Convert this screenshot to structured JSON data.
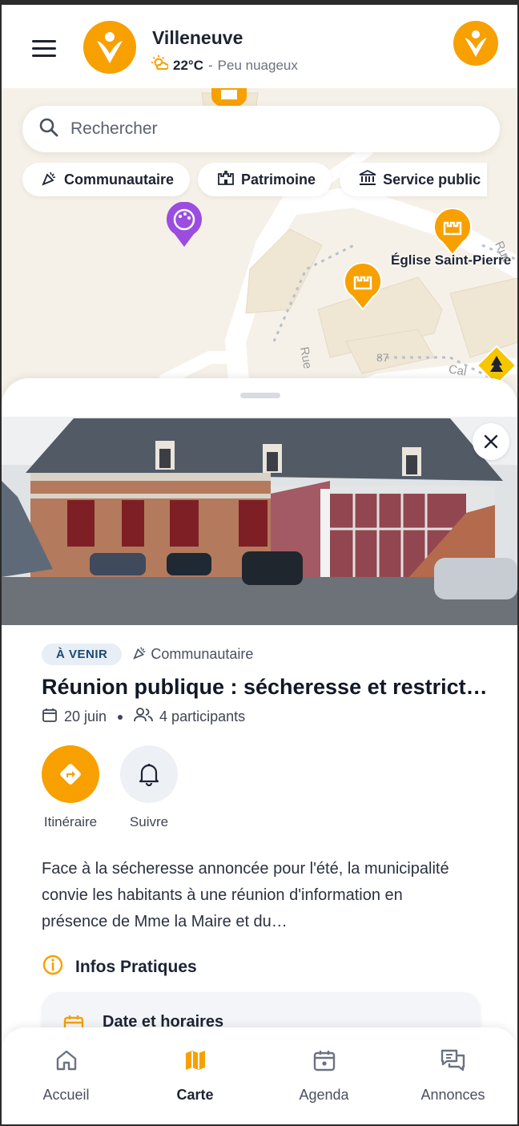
{
  "header": {
    "city": "Villeneuve",
    "temperature": "22°C",
    "separator": "-",
    "condition": "Peu nuageux"
  },
  "search": {
    "placeholder": "Rechercher"
  },
  "filters": [
    {
      "label": "Communautaire",
      "icon": "party-popper-icon"
    },
    {
      "label": "Patrimoine",
      "icon": "castle-icon"
    },
    {
      "label": "Service public",
      "icon": "bank-icon"
    }
  ],
  "map": {
    "place_label": "Église Saint-Pierre",
    "street_1": "Rue",
    "street_2": "Cal",
    "street_3": "Rue",
    "house_number": "87"
  },
  "event": {
    "status": "À VENIR",
    "category": "Communautaire",
    "title": "Réunion publique : sécheresse et restrict…",
    "date": "20 juin",
    "participants": "4 participants",
    "actions": {
      "directions": "Itinéraire",
      "follow": "Suivre"
    },
    "description": "Face à la sécheresse annoncée pour l'été, la municipalité convie les habitants à une réunion d'information en présence de Mme la Maire et du…",
    "infos_title": "Infos Pratiques",
    "schedule_title": "Date et horaires"
  },
  "nav": {
    "home": "Accueil",
    "map": "Carte",
    "agenda": "Agenda",
    "announcements": "Annonces",
    "active": "Carte"
  },
  "colors": {
    "accent": "#f7a000",
    "purple_pin": "#9b4de0",
    "badge_bg": "#e7eef6",
    "badge_text": "#1b4a72"
  }
}
